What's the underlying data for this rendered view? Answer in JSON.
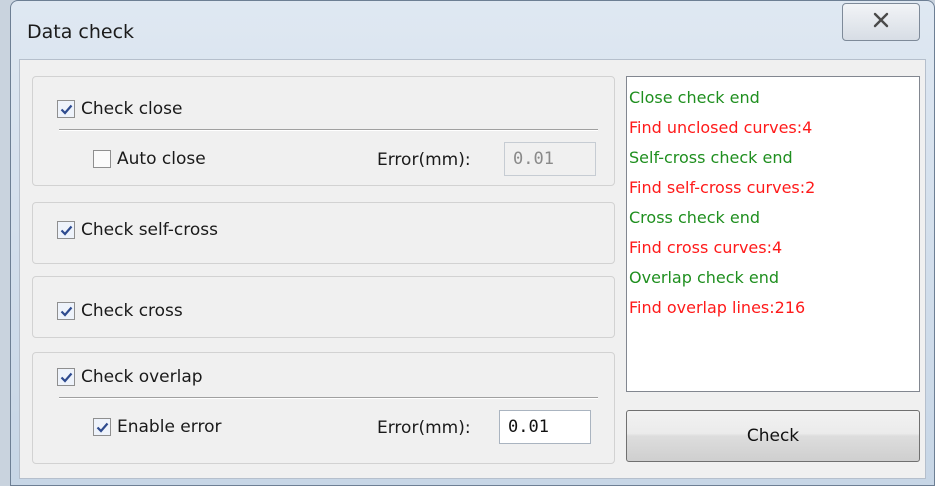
{
  "window": {
    "title": "Data check",
    "close_icon": "close-icon"
  },
  "groups": {
    "close": {
      "label": "Check close",
      "checked": true,
      "sub_label": "Auto close",
      "sub_checked": false,
      "error_label": "Error(mm):",
      "error_value": "0.01",
      "error_enabled": false
    },
    "selfcross": {
      "label": "Check self-cross",
      "checked": true
    },
    "cross": {
      "label": "Check cross",
      "checked": true
    },
    "overlap": {
      "label": "Check overlap",
      "checked": true,
      "sub_label": "Enable error",
      "sub_checked": true,
      "error_label": "Error(mm):",
      "error_value": "0.01",
      "error_enabled": true
    }
  },
  "log": {
    "colors": {
      "ok": "#1f8f1f",
      "warn": "#ff1a1a"
    },
    "lines": [
      {
        "text": "Close check end",
        "type": "ok"
      },
      {
        "text": "Find unclosed curves:4",
        "type": "warn"
      },
      {
        "text": "Self-cross check end",
        "type": "ok"
      },
      {
        "text": "Find self-cross curves:2",
        "type": "warn"
      },
      {
        "text": "Cross check end",
        "type": "ok"
      },
      {
        "text": "Find cross curves:4",
        "type": "warn"
      },
      {
        "text": "Overlap check end",
        "type": "ok"
      },
      {
        "text": "Find overlap lines:216",
        "type": "warn"
      }
    ]
  },
  "check_button": {
    "label": "Check"
  }
}
